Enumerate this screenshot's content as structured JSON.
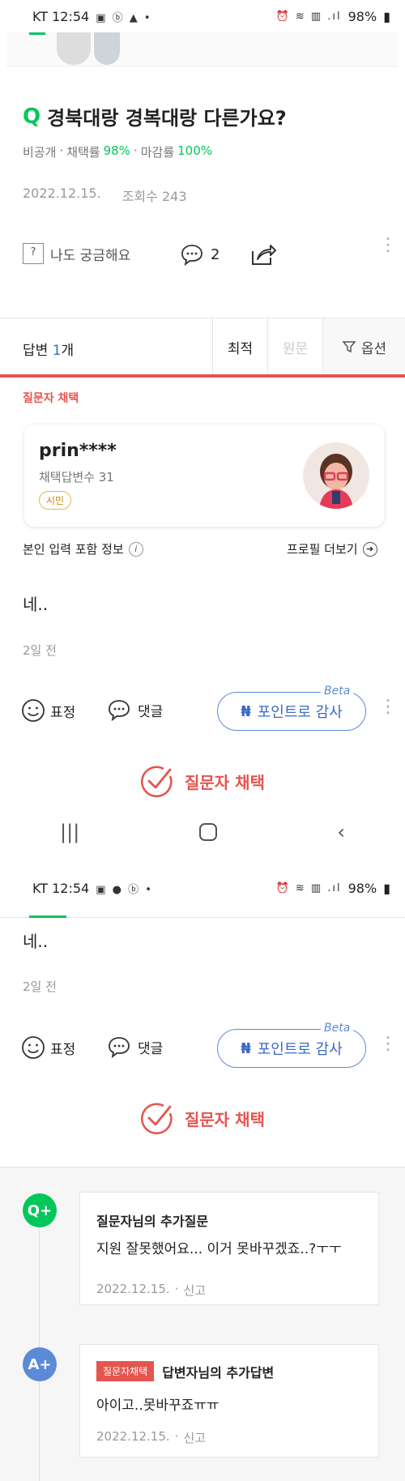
{
  "status_bar_1": {
    "carrier": "KT",
    "time": "12:54",
    "battery": "98%"
  },
  "status_bar_2": {
    "carrier": "KT",
    "time": "12:54",
    "battery": "98%"
  },
  "question": {
    "q_mark": "Q",
    "title": "경북대랑 경복대랑 다른가요?",
    "visibility": "비공개",
    "adopt_label": "채택률",
    "adopt_rate": "98%",
    "close_label": "마감률",
    "close_rate": "100%",
    "date": "2022.12.15.",
    "views_label": "조회수",
    "views": "243",
    "curious_label": "나도 궁금해요",
    "comment_count": "2"
  },
  "answers_header": {
    "label": "답변",
    "count": "1",
    "unit": "개",
    "sort_latest": "최적",
    "sort_original": "원문",
    "options": "옵션"
  },
  "answer": {
    "chosen_label": "질문자 채택",
    "author": "prin****",
    "adopted_count_label": "채택답변수 31",
    "rank_badge": "시민",
    "self_info": "본인 입력 포함 정보",
    "profile_more": "프로필 더보기",
    "content": "네..",
    "time_ago": "2일 전",
    "emotion_label": "표정",
    "comment_label": "댓글",
    "points_thanks": "포인트로 감사",
    "beta": "Beta",
    "choose_label": "질문자 채택"
  },
  "followups": [
    {
      "icon": "Q+",
      "title": "질문자님의 추가질문",
      "text": "지원 잘못했어요... 이거 못바꾸겠죠..?ㅜㅜ",
      "date": "2022.12.15.",
      "report": "신고"
    },
    {
      "icon": "A+",
      "badge": "질문자채택",
      "title": "답변자님의 추가답변",
      "text": "아이고..못바꾸죠ㅠㅠ",
      "date": "2022.12.15.",
      "report": "신고"
    }
  ],
  "colors": {
    "green": "#03c75a",
    "red": "#e5554f",
    "blue": "#5b8ad6"
  }
}
